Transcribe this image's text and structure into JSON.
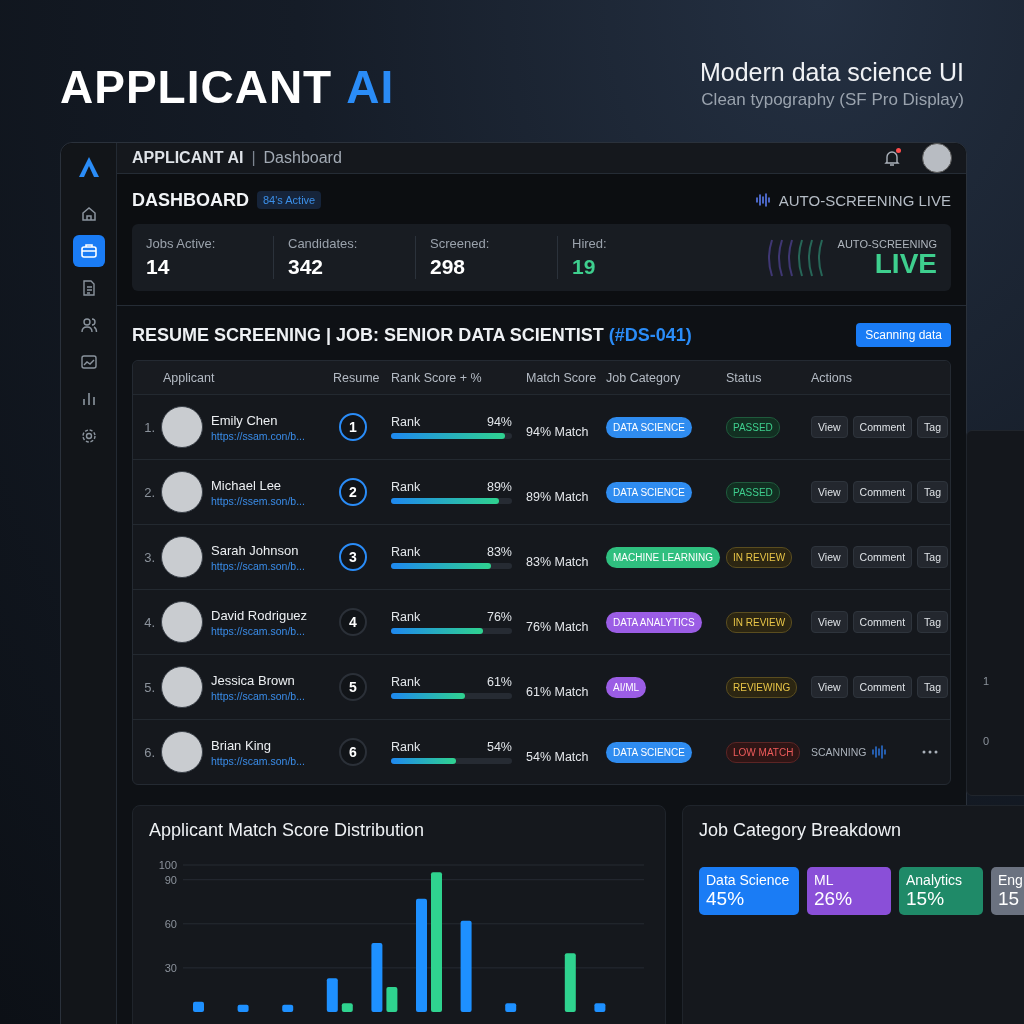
{
  "hero": {
    "brand_word": "APPLICANT",
    "brand_accent": "AI",
    "subtitle": "Modern data science UI",
    "caption": "Clean typography (SF Pro Display)"
  },
  "sidebar": {
    "items": [
      {
        "kind": "home",
        "selected": false
      },
      {
        "kind": "briefcase",
        "selected": true
      },
      {
        "kind": "document",
        "selected": false
      },
      {
        "kind": "users",
        "selected": false
      },
      {
        "kind": "image",
        "selected": false
      },
      {
        "kind": "chart",
        "selected": false
      },
      {
        "kind": "settings",
        "selected": false
      }
    ]
  },
  "topbar": {
    "app_name": "APPLICANT AI",
    "separator": "|",
    "page": "Dashboard",
    "has_notification": true
  },
  "dashboard": {
    "title": "DASHBOARD",
    "badge": "84's Active",
    "live_label": "AUTO-SCREENING LIVE",
    "stats": [
      {
        "label": "Jobs Active:",
        "value": "14",
        "highlight": false
      },
      {
        "label": "Candidates:",
        "value": "342",
        "highlight": false
      },
      {
        "label": "Screened:",
        "value": "298",
        "highlight": false
      },
      {
        "label": "Hired:",
        "value": "19",
        "highlight": true
      }
    ],
    "live_panel": {
      "caption": "AUTO-SCREENING",
      "status": "LIVE"
    }
  },
  "screening": {
    "title": "RESUME SCREENING",
    "separator": "|",
    "job": "JOB: SENIOR DATA SCIENTIST",
    "job_id": "(#DS-041)",
    "button": "Scanning data",
    "columns": [
      "Applicant",
      "Resume",
      "Rank Score + %",
      "Match Score",
      "Job Category",
      "Status",
      "Actions"
    ],
    "rows": [
      {
        "index": "1.",
        "name": "Emily Chen",
        "link": "https://ssam.con/b...",
        "resume": "1",
        "highlighted": true,
        "rank_label": "Rank",
        "rank": "94%",
        "level": 0.94,
        "match": "94% Match",
        "category": {
          "label": "DATA SCIENCE",
          "color": "#2f8cf0"
        },
        "status": {
          "label": "PASSED",
          "kind": "passed"
        },
        "kind": "buttons",
        "actions": [
          "View",
          "Comment",
          "Tag"
        ]
      },
      {
        "index": "2.",
        "name": "Michael Lee",
        "link": "https://ssem.son/b...",
        "resume": "2",
        "highlighted": true,
        "rank_label": "Rank",
        "rank": "89%",
        "level": 0.89,
        "match": "89% Match",
        "category": {
          "label": "DATA SCIENCE",
          "color": "#2f8cf0"
        },
        "status": {
          "label": "PASSED",
          "kind": "passed"
        },
        "kind": "buttons",
        "actions": [
          "View",
          "Comment",
          "Tag"
        ]
      },
      {
        "index": "3.",
        "name": "Sarah Johnson",
        "link": "https://scam.son/b...",
        "resume": "3",
        "highlighted": true,
        "rank_label": "Rank",
        "rank": "83%",
        "level": 0.83,
        "match": "83% Match",
        "category": {
          "label": "MACHINE LEARNING",
          "color": "#2fbf7f"
        },
        "status": {
          "label": "IN REVIEW",
          "kind": "review"
        },
        "kind": "buttons",
        "actions": [
          "View",
          "Comment",
          "Tag"
        ]
      },
      {
        "index": "4.",
        "name": "David Rodriguez",
        "link": "https://scam.son/b...",
        "resume": "4",
        "highlighted": false,
        "rank_label": "Rank",
        "rank": "76%",
        "level": 0.76,
        "match": "76% Match",
        "category": {
          "label": "DATA ANALYTICS",
          "color": "#9b5de5"
        },
        "status": {
          "label": "IN REVIEW",
          "kind": "review"
        },
        "kind": "buttons",
        "actions": [
          "View",
          "Comment",
          "Tag"
        ]
      },
      {
        "index": "5.",
        "name": "Jessica Brown",
        "link": "https://scam.son/b...",
        "resume": "5",
        "highlighted": false,
        "rank_label": "Rank",
        "rank": "61%",
        "level": 0.61,
        "match": "61% Match",
        "category": {
          "label": "AI/ML",
          "color": "#9b5de5"
        },
        "status": {
          "label": "REVIEWING",
          "kind": "review"
        },
        "kind": "buttons",
        "actions": [
          "View",
          "Comment",
          "Tag"
        ]
      },
      {
        "index": "6.",
        "name": "Brian King",
        "link": "https://scam.son/b...",
        "resume": "6",
        "highlighted": false,
        "rank_label": "Rank",
        "rank": "54%",
        "level": 0.54,
        "match": "54% Match",
        "category": {
          "label": "DATA SCIENCE",
          "color": "#2f8cf0"
        },
        "status": {
          "label": "LOW MATCH",
          "kind": "low"
        },
        "kind": "scanning",
        "scanning_label": "SCANNING"
      }
    ]
  },
  "side_panel": {
    "axis_labels": [
      "1",
      "0"
    ]
  },
  "distribution": {
    "title": "Applicant Match Score Distribution",
    "chart_data": {
      "type": "bar",
      "grid": true,
      "ylim": [
        0,
        100
      ],
      "yticks": [
        30,
        60,
        90,
        100
      ],
      "series": [
        {
          "color": "#1e90ff",
          "values": [
            7,
            5,
            5,
            23,
            47,
            77,
            62,
            6,
            null,
            6
          ]
        },
        {
          "color": "#2fd38f",
          "values": [
            null,
            null,
            null,
            6,
            17,
            95,
            null,
            null,
            40,
            null
          ]
        }
      ]
    }
  },
  "breakdown": {
    "title": "Job Category Breakdown",
    "categories": [
      {
        "name": "Data Science",
        "share": "45%",
        "color": "#1a7cf5"
      },
      {
        "name": "ML",
        "share": "26%",
        "color": "#8a4fd8"
      },
      {
        "name": "Analytics",
        "share": "15%",
        "color": "#1f8a68"
      },
      {
        "name": "Eng",
        "share": "15",
        "color": "#6b7280"
      }
    ]
  }
}
